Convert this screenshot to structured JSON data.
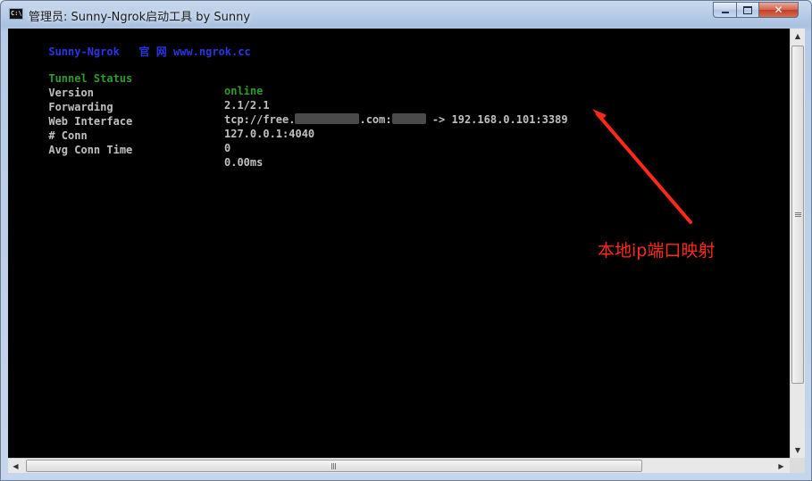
{
  "window": {
    "icon_label": "C:\\",
    "title": "管理员: Sunny-Ngrok启动工具 by Sunny"
  },
  "console": {
    "header": {
      "name": "Sunny-Ngrok",
      "site_label": "官 网",
      "url": "www.ngrok.cc"
    },
    "rows": [
      {
        "label": "Tunnel Status",
        "value": "online"
      },
      {
        "label": "Version",
        "value": "2.1/2.1"
      },
      {
        "label": "Forwarding",
        "value_prefix": "tcp://free.",
        "value_mid": ".com:",
        "value_suffix": " -> 192.168.0.101:3389"
      },
      {
        "label": "Web Interface",
        "value": "127.0.0.1:4040"
      },
      {
        "label": "# Conn",
        "value": "0"
      },
      {
        "label": "Avg Conn Time",
        "value": "0.00ms"
      }
    ]
  },
  "annotation": {
    "text": "本地ip端口映射",
    "color": "#ff2a1a"
  },
  "colors": {
    "console_bg": "#000000",
    "header_blue": "#2b35e3",
    "status_green": "#2d9c2d",
    "text_gray": "#c0c0c0"
  }
}
